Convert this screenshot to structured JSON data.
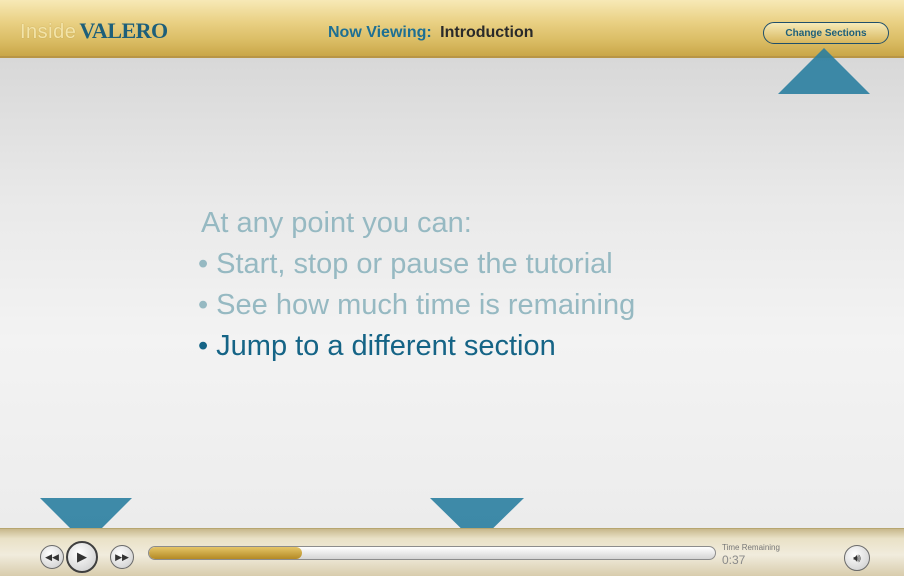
{
  "header": {
    "logo_inside": "Inside",
    "logo_valero": "VALERO",
    "now_viewing_label": "Now Viewing:",
    "now_viewing_title": "Introduction",
    "change_sections_label": "Change Sections"
  },
  "slide": {
    "intro": "At any point you can:",
    "bullets": [
      {
        "text": "Start, stop or pause the tutorial",
        "active": false
      },
      {
        "text": "See how much time is remaining",
        "active": false
      },
      {
        "text": "Jump to a different section",
        "active": true
      }
    ],
    "bullet_glyph": "•",
    "text_color": "#96b9c2",
    "active_color": "#156486"
  },
  "player": {
    "rewind_icon": "rewind-icon",
    "play_icon": "play-icon",
    "forward_icon": "fast-forward-icon",
    "progress": 0.27,
    "time_label": "Time Remaining",
    "time_value": "0:37",
    "volume_icon": "speaker-icon"
  },
  "colors": {
    "accent_blue": "#1d6f93",
    "gold": "#d9bb62",
    "pointer_blue": "#2a7ea0"
  }
}
